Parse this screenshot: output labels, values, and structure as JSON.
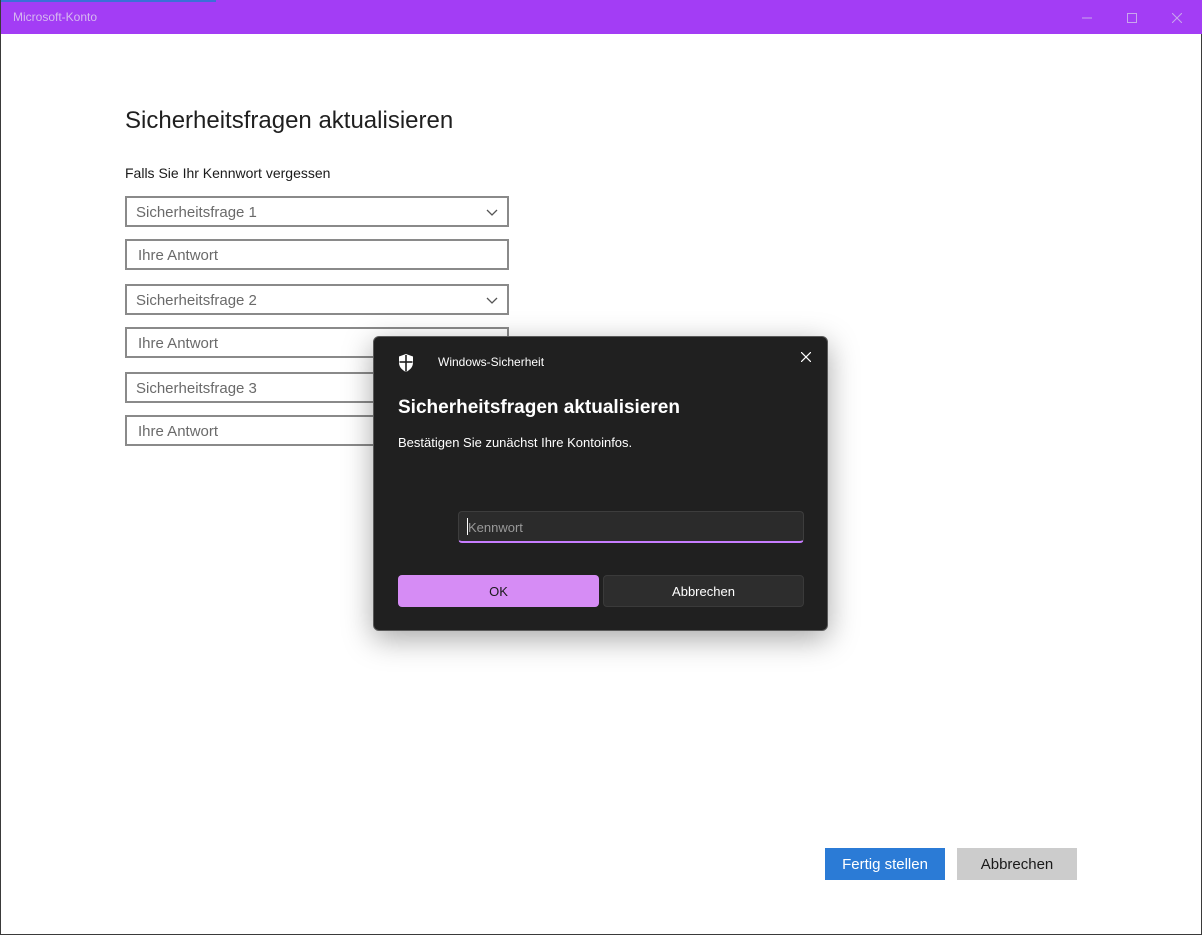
{
  "window": {
    "title": "Microsoft-Konto"
  },
  "form": {
    "heading": "Sicherheitsfragen aktualisieren",
    "subheading": "Falls Sie Ihr Kennwort vergessen",
    "question1": "Sicherheitsfrage 1",
    "answer1_placeholder": "Ihre Antwort",
    "question2": "Sicherheitsfrage 2",
    "answer2_placeholder": "Ihre Antwort",
    "question3": "Sicherheitsfrage 3",
    "answer3_placeholder": "Ihre Antwort"
  },
  "footer": {
    "finish_label": "Fertig stellen",
    "cancel_label": "Abbrechen"
  },
  "dialog": {
    "app_name": "Windows-Sicherheit",
    "title": "Sicherheitsfragen aktualisieren",
    "text": "Bestätigen Sie zunächst Ihre Kontoinfos.",
    "password_placeholder": "Kennwort",
    "ok_label": "OK",
    "cancel_label": "Abbrechen"
  },
  "icons": {
    "titlebar": [
      "minimize-icon",
      "maximize-icon",
      "close-icon"
    ],
    "dropdown": "chevron-down-icon",
    "dialog": [
      "shield-icon",
      "close-icon"
    ]
  },
  "colors": {
    "titlebar": "#a33df5",
    "primary_button": "#2b7bd6",
    "secondary_button": "#cccccc",
    "dialog_background": "#202020",
    "dialog_accent": "#d68cf5"
  }
}
